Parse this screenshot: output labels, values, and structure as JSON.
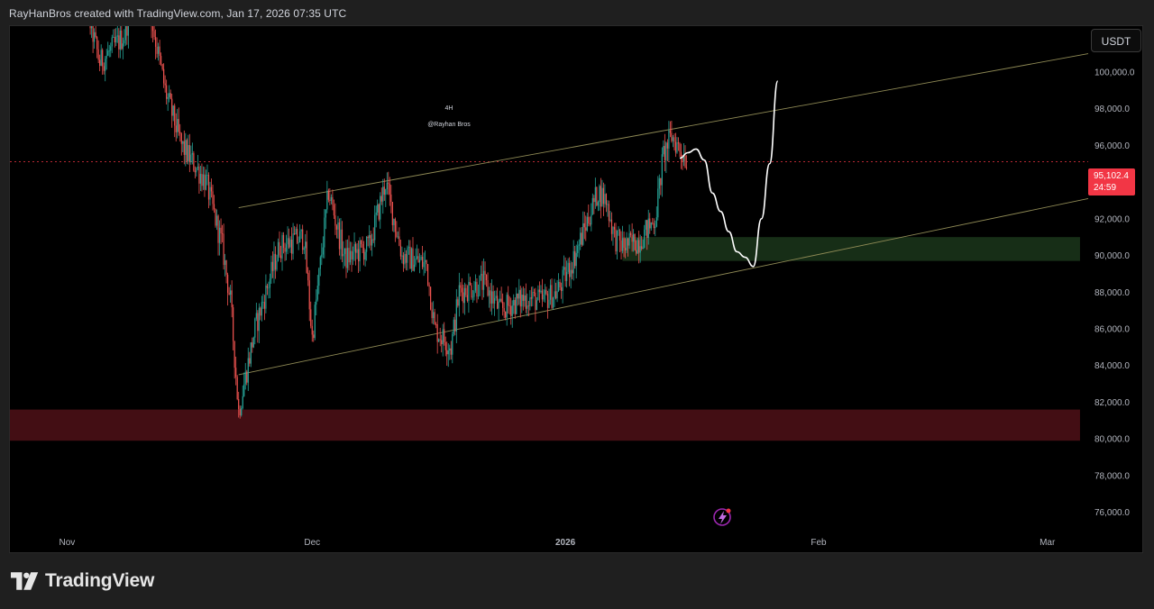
{
  "header": {
    "text": "RayHanBros created with TradingView.com, Jan 17, 2026 07:35 UTC"
  },
  "currency_button": {
    "label": "USDT"
  },
  "last_price": {
    "value": "95,102.4",
    "countdown": "24:59"
  },
  "brand": {
    "name": "TradingView"
  },
  "colors": {
    "up": "#26a69a",
    "down": "#ef5350",
    "channel": "#8f8a55",
    "support_zone": "#1f3d1f",
    "demand_zone": "#4a0f16",
    "price_line": "#f23645",
    "projection": "#ffffff"
  },
  "chart_data": {
    "type": "candlestick",
    "timeframe_label": "4H",
    "author_label": "@Rayhan Bros",
    "symbol_currency": "USDT",
    "x_ticks": [
      "Nov",
      "Dec",
      "2026",
      "Feb",
      "Mar"
    ],
    "y_ticks": [
      "100,000.0",
      "98,000.0",
      "96,000.0",
      "94,000.0",
      "92,000.0",
      "90,000.0",
      "88,000.0",
      "86,000.0",
      "84,000.0",
      "82,000.0",
      "80,000.0",
      "78,000.0",
      "76,000.0"
    ],
    "y_range": [
      75000,
      102500
    ],
    "x_range": [
      "2025-10-25",
      "2026-03-06"
    ],
    "last_price": 95102.4,
    "channel": {
      "upper": [
        [
          "2025-11-22",
          92600
        ],
        [
          "2026-03-06",
          101000
        ]
      ],
      "lower": [
        [
          "2025-11-22",
          83500
        ],
        [
          "2026-03-06",
          93100
        ]
      ]
    },
    "zones": [
      {
        "name": "support",
        "from_date": "2026-01-08",
        "to_date": "2026-03-05",
        "low": 89700,
        "high": 91000
      },
      {
        "name": "demand",
        "from_date": "2025-10-25",
        "to_date": "2026-03-05",
        "low": 79900,
        "high": 81600
      }
    ],
    "projection": [
      [
        "2026-01-15",
        95300
      ],
      [
        "2026-01-16",
        95600
      ],
      [
        "2026-01-17",
        95800
      ],
      [
        "2026-01-18",
        95200
      ],
      [
        "2026-01-19",
        93400
      ],
      [
        "2026-01-20",
        92400
      ],
      [
        "2026-01-21",
        91300
      ],
      [
        "2026-01-22",
        90200
      ],
      [
        "2026-01-23",
        89900
      ],
      [
        "2026-01-24",
        89400
      ],
      [
        "2026-01-25",
        92000
      ],
      [
        "2026-01-26",
        95000
      ],
      [
        "2026-01-27",
        99500
      ]
    ],
    "key_path": [
      [
        "2025-11-02",
        106000
      ],
      [
        "2025-11-05",
        100500
      ],
      [
        "2025-11-08",
        102000
      ],
      [
        "2025-11-10",
        106000
      ],
      [
        "2025-11-13",
        99000
      ],
      [
        "2025-11-15",
        96000
      ],
      [
        "2025-11-18",
        94000
      ],
      [
        "2025-11-20",
        90500
      ],
      [
        "2025-11-21",
        87500
      ],
      [
        "2025-11-22",
        81500
      ],
      [
        "2025-11-24",
        86000
      ],
      [
        "2025-11-27",
        90500
      ],
      [
        "2025-11-30",
        91000
      ],
      [
        "2025-12-01",
        85500
      ],
      [
        "2025-12-03",
        93500
      ],
      [
        "2025-12-05",
        89800
      ],
      [
        "2025-12-08",
        90500
      ],
      [
        "2025-12-10",
        94000
      ],
      [
        "2025-12-12",
        90000
      ],
      [
        "2025-12-15",
        89500
      ],
      [
        "2025-12-16",
        86000
      ],
      [
        "2025-12-18",
        85000
      ],
      [
        "2025-12-19",
        88000
      ],
      [
        "2025-12-22",
        88500
      ],
      [
        "2025-12-24",
        87000
      ],
      [
        "2025-12-27",
        87700
      ],
      [
        "2025-12-29",
        87500
      ],
      [
        "2025-12-31",
        88000
      ],
      [
        "2026-01-02",
        89800
      ],
      [
        "2026-01-05",
        93500
      ],
      [
        "2026-01-06",
        93000
      ],
      [
        "2026-01-07",
        91000
      ],
      [
        "2026-01-08",
        90500
      ],
      [
        "2026-01-10",
        90800
      ],
      [
        "2026-01-12",
        92000
      ],
      [
        "2026-01-13",
        95500
      ],
      [
        "2026-01-14",
        96500
      ],
      [
        "2026-01-15",
        95800
      ],
      [
        "2026-01-16",
        95100
      ]
    ]
  }
}
